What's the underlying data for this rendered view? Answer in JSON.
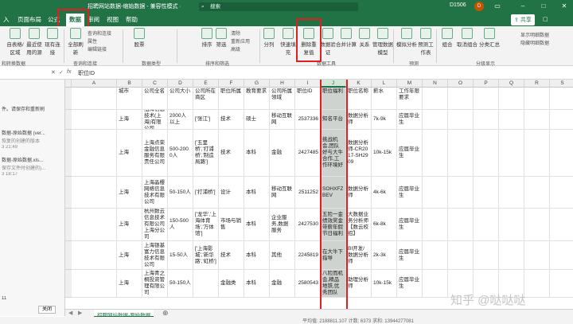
{
  "titlebar": {
    "title": "招聘网站数据-缩始数据 - 兼容性模式 ·",
    "search_placeholder": "搜索",
    "user": "D1506",
    "avatar": "D"
  },
  "tabs": [
    "入",
    "页面布局",
    "公式",
    "数据",
    "审阅",
    "视图",
    "帮助"
  ],
  "share_label": "共享",
  "comment_label": "",
  "ribbon": {
    "buttons": [
      {
        "label": "自表格/区域",
        "name": "from-table-button"
      },
      {
        "label": "最近使用的源",
        "name": "recent-sources-button"
      },
      {
        "label": "现有连接",
        "name": "existing-connections-button"
      },
      {
        "label": "全部刷新",
        "name": "refresh-all-button"
      },
      {
        "label": "股票",
        "name": "stocks-button"
      },
      {
        "label": "排序",
        "name": "sort-button"
      },
      {
        "label": "筛选",
        "name": "filter-button"
      },
      {
        "label": "分列",
        "name": "text-to-columns-button"
      },
      {
        "label": "快速填充",
        "name": "flash-fill-button"
      },
      {
        "label": "删除重复值",
        "name": "remove-duplicates-button"
      },
      {
        "label": "数据验证",
        "name": "data-validation-button"
      },
      {
        "label": "合并计算",
        "name": "consolidate-button"
      },
      {
        "label": "关系",
        "name": "relationships-button"
      },
      {
        "label": "管理数据模型",
        "name": "manage-data-model-button"
      },
      {
        "label": "模拟分析",
        "name": "what-if-button"
      },
      {
        "label": "预测工作表",
        "name": "forecast-sheet-button"
      },
      {
        "label": "组合",
        "name": "group-button"
      },
      {
        "label": "取消组合",
        "name": "ungroup-button"
      },
      {
        "label": "分类汇总",
        "name": "subtotal-button"
      }
    ],
    "small": {
      "queries": "查询和连接",
      "properties": "属性",
      "edit_links": "编辑链接",
      "clear": "清除",
      "reapply": "重新应用",
      "advanced": "高级",
      "show_detail": "显示明细数据",
      "hide_detail": "隐藏明细数据"
    },
    "groups": [
      "和转换数据",
      "查询和连接",
      "数据类型",
      "排序和筛选",
      "数据工具",
      "预测",
      "分级显示"
    ]
  },
  "formula_bar": {
    "namebox": "",
    "formula": "职位ID"
  },
  "left_pane": {
    "lines": [
      "件。请保存和重新刷",
      "数据-原始数据 (ver...",
      "恢复的创建的版本",
      "3 21:49",
      "数据-原始数据.xls...",
      "保存文件时创建的)...",
      "3 18:17",
      "11"
    ],
    "close_label": "关闭"
  },
  "grid": {
    "columns": [
      "A",
      "B",
      "C",
      "D",
      "E",
      "F",
      "G",
      "H",
      "I",
      "J",
      "K",
      "L",
      "M",
      "N",
      "O",
      "P",
      "Q",
      "R",
      "S",
      "T",
      "U"
    ],
    "selected_column": "J",
    "header_row": [
      "城市",
      "公司全名",
      "公司大小",
      "公司所在商区",
      "职位所属",
      "教育要求",
      "公司所属领域",
      "职位ID",
      "职位福利",
      "职位名称",
      "薪水",
      "工作年限要求"
    ],
    "rows": [
      [
        "上海",
        "纽海信息技术(上海)有限公司",
        "2000人以上",
        "['张江']",
        "技术",
        "硕士",
        "移动互联网",
        "2537336",
        "知名平台",
        "数据分析师",
        "7k-9k",
        "应届毕业生"
      ],
      [
        "上海",
        "上海点荣金融信息服务有限责任公司",
        "500-2000人",
        "['五里桥','打浦桥','制造局路']",
        "技术",
        "本科",
        "金融",
        "2427485",
        "挑战机会,团队好与大牛合作,工作环境好",
        "数据分析师-CR2017-SH2909",
        "10k-15k",
        "应届毕业生"
      ],
      [
        "上海",
        "上海晶樱网络信息技术有限公司",
        "50-150人",
        "['打浦桥']",
        "设计",
        "本科",
        "移动互联网",
        "2511252",
        "SOHXFZBEV",
        "数据分析师",
        "4k-6k",
        "应届毕业生"
      ],
      [
        "上海",
        "杭州数云信息技术有限公司上海分公司",
        "150-500人",
        "['龙华','上海体育场','万体馆']",
        "市场与销售",
        "本科",
        "企业服务,数据服务",
        "2427530",
        "五险一金绩效奖金带薪年假节日福利",
        "大数据业务分析师【数云校招】",
        "6k-8k",
        "应届毕业生"
      ],
      [
        "上海",
        "上海银基富力信息技术有限公司",
        "15-50人",
        "['上海影城','新华路','虹桥']",
        "技术",
        "本科",
        "其他",
        "2245819",
        "在大牛下指导",
        "BI开发/数据分析师",
        "2k-3k",
        "应届毕业生"
      ],
      [
        "上海",
        "上海青之桐投资管理有限公司",
        "50-150人",
        "",
        "金融类",
        "本科",
        "金融",
        "2580543",
        "八险而机会,精品地铁,优秀团队",
        "助理分析师",
        "10k-15k",
        "应届毕业生"
      ]
    ]
  },
  "sheet_tab": "招聘网站数据-原始数据",
  "status_text": "平均值: 2188811.107    计数: 6373    求和: 13944277081",
  "watermark": "知乎 @哒哒哒"
}
